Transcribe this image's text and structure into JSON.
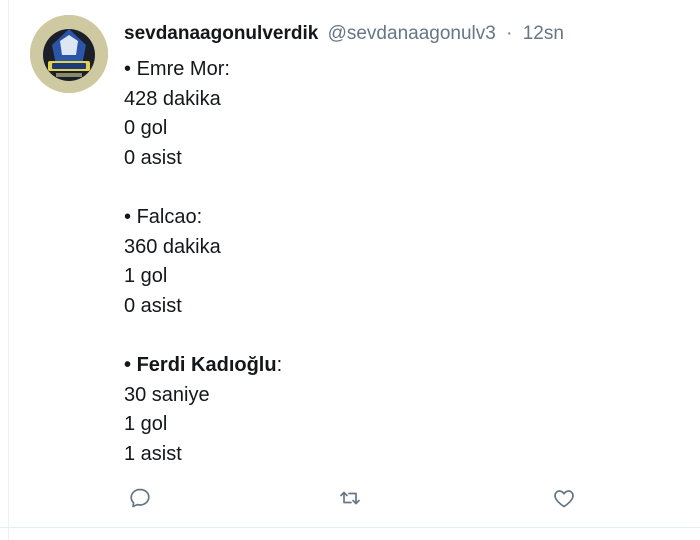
{
  "tweet": {
    "display_name": "sevdanaagonulverdik",
    "handle": "@sevdanaagonulv3",
    "separator": "·",
    "timestamp": "12sn",
    "lines": [
      {
        "bullet": "•",
        "text": "Emre Mor",
        "suffix": ":",
        "bold": false
      },
      {
        "text": "428 dakika"
      },
      {
        "text": "0 gol"
      },
      {
        "text": "0 asist"
      },
      {
        "text": ""
      },
      {
        "bullet": "•",
        "text": "Falcao",
        "suffix": ":",
        "bold": false
      },
      {
        "text": "360 dakika"
      },
      {
        "text": "1 gol"
      },
      {
        "text": "0 asist"
      },
      {
        "text": ""
      },
      {
        "bullet": "•",
        "text": "Ferdi Kadıoğlu",
        "suffix": ":",
        "bold": true
      },
      {
        "text": "30 saniye"
      },
      {
        "text": "1 gol"
      },
      {
        "text": "1 asist"
      }
    ]
  },
  "actions": {
    "reply_icon": "reply-icon",
    "retweet_icon": "retweet-icon",
    "like_icon": "heart-icon",
    "icon_color": "#657786"
  }
}
